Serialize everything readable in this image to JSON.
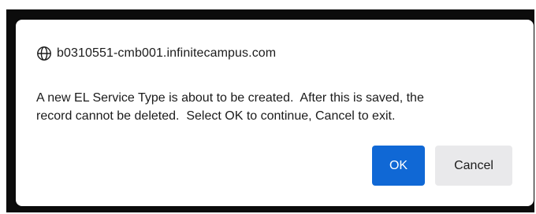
{
  "dialog": {
    "origin": "b0310551-cmb001.infinitecampus.com",
    "origin_icon": "globe-icon",
    "message": "A new EL Service Type is about to be created.  After this is saved, the\nrecord cannot be deleted.  Select OK to continue, Cancel to exit.",
    "ok_label": "OK",
    "cancel_label": "Cancel"
  },
  "colors": {
    "primary_button": "#1068d5",
    "secondary_button": "#e9e9eb",
    "backdrop": "#0c0c0c"
  }
}
